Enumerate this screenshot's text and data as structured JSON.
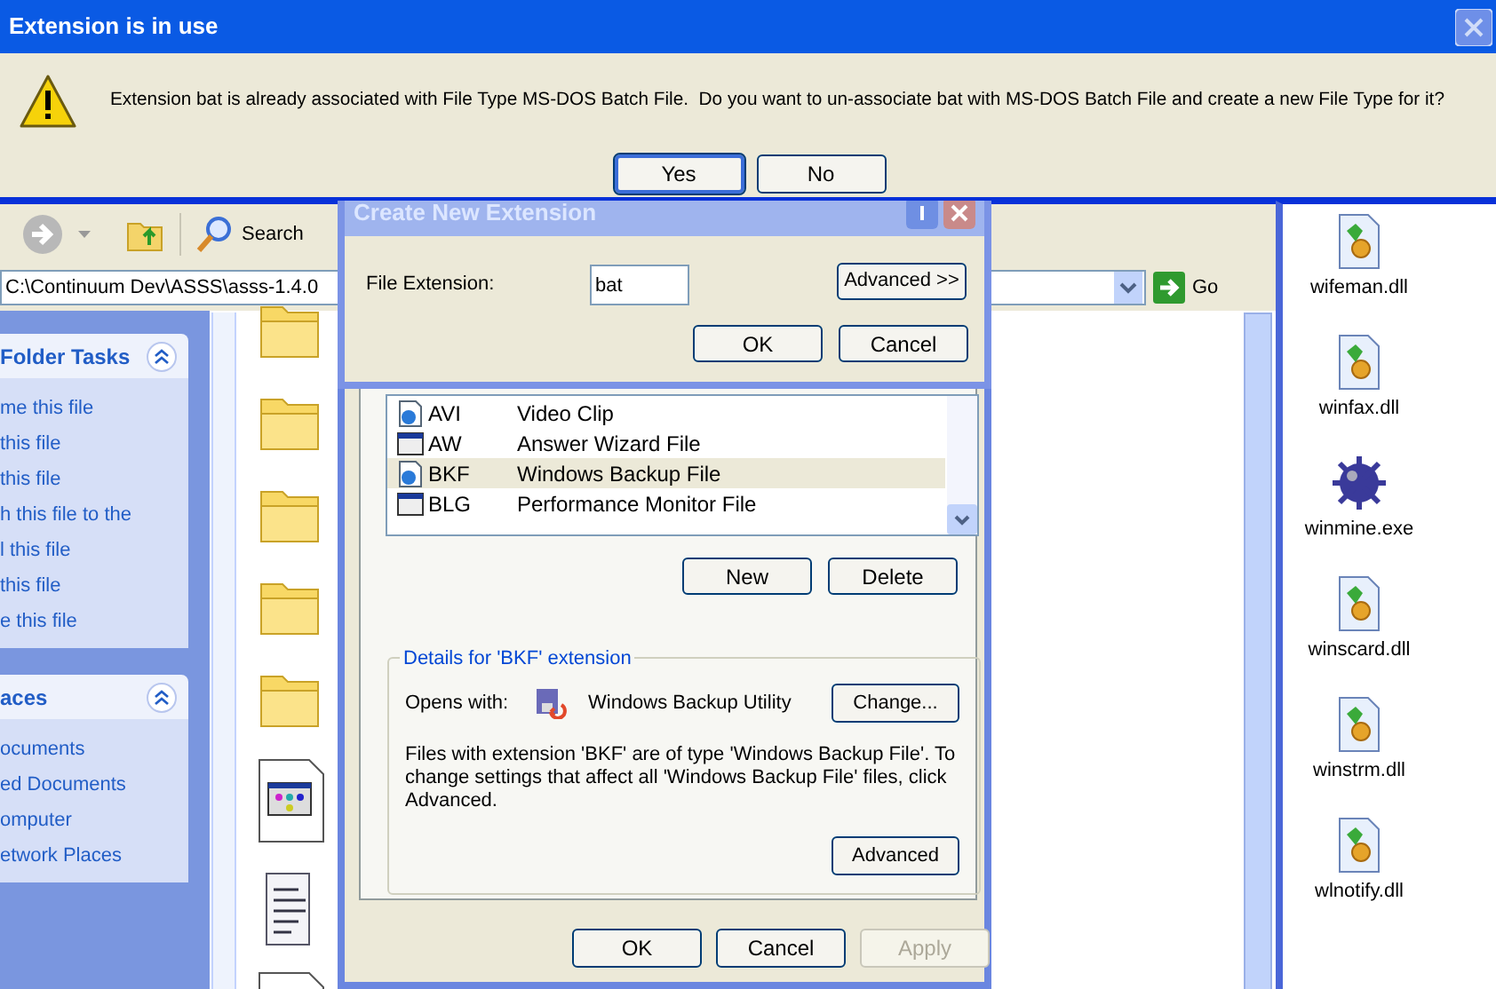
{
  "explorer": {
    "search_label": "Search",
    "address": "C:\\Continuum Dev\\ASSS\\asss-1.4.0",
    "go_label": "Go",
    "task_panes": [
      {
        "title": "Folder Tasks",
        "items": [
          "me this file",
          "this file",
          "this file",
          "h this file to the",
          "l this file",
          "this file",
          "e this file"
        ]
      },
      {
        "title": "aces",
        "items": [
          "ocuments",
          "ed Documents",
          "omputer",
          "etwork Places"
        ]
      }
    ],
    "file_icons": [
      {
        "kind": "folder"
      },
      {
        "kind": "folder"
      },
      {
        "kind": "folder"
      },
      {
        "kind": "folder"
      },
      {
        "kind": "folder"
      },
      {
        "kind": "window"
      },
      {
        "kind": "note"
      },
      {
        "kind": "page"
      }
    ]
  },
  "right_window": {
    "files": [
      {
        "name": "wifeman.dll",
        "kind": "dll"
      },
      {
        "name": "winfax.dll",
        "kind": "dll"
      },
      {
        "name": "winmine.exe",
        "kind": "mine"
      },
      {
        "name": "winscard.dll",
        "kind": "dll"
      },
      {
        "name": "winstrm.dll",
        "kind": "dll"
      },
      {
        "name": "wlnotify.dll",
        "kind": "dll"
      }
    ]
  },
  "folder_options": {
    "file_types": [
      {
        "ext": "AVI",
        "type": "Video Clip",
        "selected": false
      },
      {
        "ext": "AW",
        "type": "Answer Wizard File",
        "selected": false
      },
      {
        "ext": "BKF",
        "type": "Windows Backup File",
        "selected": true
      },
      {
        "ext": "BLG",
        "type": "Performance Monitor File",
        "selected": false
      }
    ],
    "list_buttons": [
      "New",
      "Delete"
    ],
    "details": {
      "legend": "Details for 'BKF' extension",
      "opens_with_label": "Opens with:",
      "program": "Windows Backup Utility",
      "change_button": "Change...",
      "description": "Files with extension 'BKF' are of type 'Windows Backup File'.  To change settings that affect all 'Windows Backup File' files, click Advanced.",
      "advanced_button": "Advanced"
    },
    "footer_buttons": [
      {
        "label": "OK",
        "disabled": false
      },
      {
        "label": "Cancel",
        "disabled": false
      },
      {
        "label": "Apply",
        "disabled": true
      }
    ]
  },
  "create_extension": {
    "title": "Create New Extension",
    "field_label": "File Extension:",
    "field_value": "bat",
    "advanced_button": "Advanced >>",
    "buttons": [
      "OK",
      "Cancel"
    ]
  },
  "alert": {
    "title": "Extension is in use",
    "message": "Extension bat is already associated with File Type MS-DOS Batch File.  Do you want to un-associate bat with MS-DOS Batch File and create a new File Type for it?",
    "buttons": [
      {
        "label": "Yes",
        "focused": true
      },
      {
        "label": "No",
        "focused": false
      }
    ]
  }
}
